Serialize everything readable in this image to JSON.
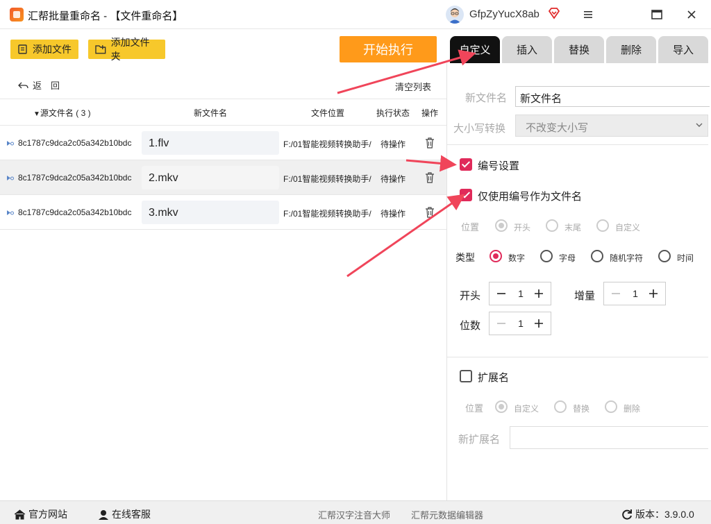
{
  "titlebar": {
    "title": "汇帮批量重命名 - 【文件重命名】",
    "username": "GfpZyYucX8ab"
  },
  "toolbar": {
    "add_file": "添加文件",
    "add_folder": "添加文件夹",
    "start": "开始执行",
    "back": "返　回",
    "clear_list": "清空列表"
  },
  "tabs": [
    {
      "label": "自定义"
    },
    {
      "label": "插入"
    },
    {
      "label": "替换"
    },
    {
      "label": "删除"
    },
    {
      "label": "导入"
    }
  ],
  "table": {
    "headers": {
      "source": "源文件名 ( 3 )",
      "new_name": "新文件名",
      "location": "文件位置",
      "status": "执行状态",
      "action": "操作"
    },
    "rows": [
      {
        "source": "8c1787c9dca2c05a342b10bdc",
        "new_name": "1.flv",
        "location": "F:/01智能视频转换助手/",
        "status": "待操作"
      },
      {
        "source": "8c1787c9dca2c05a342b10bdc",
        "new_name": "2.mkv",
        "location": "F:/01智能视频转换助手/",
        "status": "待操作"
      },
      {
        "source": "8c1787c9dca2c05a342b10bdc",
        "new_name": "3.mkv",
        "location": "F:/01智能视频转换助手/",
        "status": "待操作"
      }
    ]
  },
  "panel": {
    "new_filename_label": "新文件名",
    "new_filename_value": "新文件名",
    "case_label": "大小写转换",
    "case_value": "不改变大小写",
    "numbering_label": "编号设置",
    "numbering_checked": true,
    "only_number_label": "仅使用编号作为文件名",
    "only_number_checked": true,
    "position_label": "位置",
    "position_options": [
      "开头",
      "末尾",
      "自定义"
    ],
    "type_label": "类型",
    "type_options": [
      "数字",
      "字母",
      "随机字符",
      "时间"
    ],
    "start_label": "开头",
    "start_value": "1",
    "increment_label": "增量",
    "increment_value": "1",
    "digits_label": "位数",
    "digits_value": "1",
    "extension_label": "扩展名",
    "extension_checked": false,
    "ext_position_label": "位置",
    "ext_position_options": [
      "自定义",
      "替换",
      "删除"
    ],
    "new_ext_label": "新扩展名",
    "new_ext_value": ""
  },
  "footer": {
    "website": "官方网站",
    "support": "在线客服",
    "link1": "汇帮汉字注音大师",
    "link2": "汇帮元数据编辑器",
    "version": "版本：3.9.0.0"
  },
  "colors": {
    "accent": "#e02a5a",
    "start_button": "#ff9a1a",
    "add_button": "#f7c82b",
    "active_tab": "#111111",
    "arrow": "#f0455a"
  }
}
